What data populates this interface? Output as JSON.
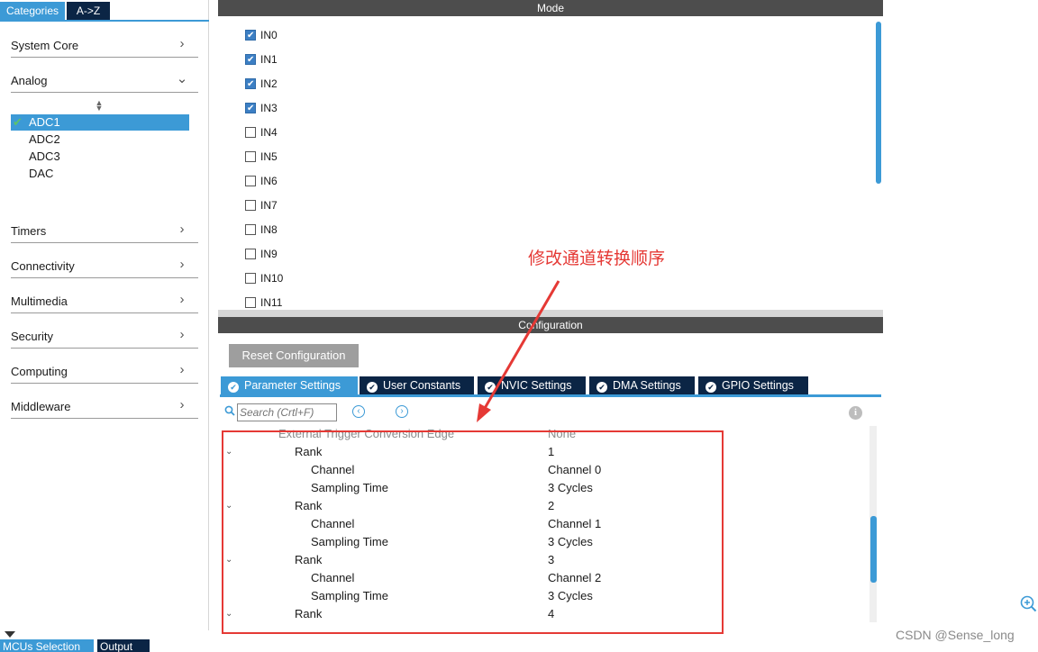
{
  "left_panel": {
    "tabs": [
      "Categories",
      "A->Z"
    ],
    "categories": {
      "system_core": "System Core",
      "analog": "Analog",
      "timers": "Timers",
      "connectivity": "Connectivity",
      "multimedia": "Multimedia",
      "security": "Security",
      "computing": "Computing",
      "middleware": "Middleware"
    },
    "analog_items": [
      "ADC1",
      "ADC2",
      "ADC3",
      "DAC"
    ],
    "selected_item": "ADC1"
  },
  "bottom_tabs": [
    "MCUs Selection",
    "Output"
  ],
  "mode": {
    "header": "Mode",
    "inputs": [
      {
        "label": "IN0",
        "checked": true
      },
      {
        "label": "IN1",
        "checked": true
      },
      {
        "label": "IN2",
        "checked": true
      },
      {
        "label": "IN3",
        "checked": true
      },
      {
        "label": "IN4",
        "checked": false
      },
      {
        "label": "IN5",
        "checked": false
      },
      {
        "label": "IN6",
        "checked": false
      },
      {
        "label": "IN7",
        "checked": false
      },
      {
        "label": "IN8",
        "checked": false
      },
      {
        "label": "IN9",
        "checked": false
      },
      {
        "label": "IN10",
        "checked": false
      },
      {
        "label": "IN11",
        "checked": false
      }
    ]
  },
  "configuration": {
    "header": "Configuration",
    "reset_button": "Reset Configuration",
    "tabs": [
      "Parameter Settings",
      "User Constants",
      "NVIC Settings",
      "DMA Settings",
      "GPIO Settings"
    ],
    "active_tab": "Parameter Settings",
    "search_placeholder": "Search (Crtl+F)",
    "params": [
      {
        "name": "External Trigger Conversion Edge",
        "value": "None"
      },
      {
        "name": "Rank",
        "value": "1"
      },
      {
        "name": "Channel",
        "value": "Channel 0"
      },
      {
        "name": "Sampling Time",
        "value": "3 Cycles"
      },
      {
        "name": "Rank",
        "value": "2"
      },
      {
        "name": "Channel",
        "value": "Channel 1"
      },
      {
        "name": "Sampling Time",
        "value": "3 Cycles"
      },
      {
        "name": "Rank",
        "value": "3"
      },
      {
        "name": "Channel",
        "value": "Channel 2"
      },
      {
        "name": "Sampling Time",
        "value": "3 Cycles"
      },
      {
        "name": "Rank",
        "value": "4"
      }
    ]
  },
  "annotation": {
    "text": "修改通道转换顺序",
    "color": "#e53935"
  },
  "watermark": "CSDN @Sense_long",
  "colors": {
    "accent": "#3c9ad6",
    "navy": "#0b2545",
    "header_gray": "#4d4d4d"
  }
}
